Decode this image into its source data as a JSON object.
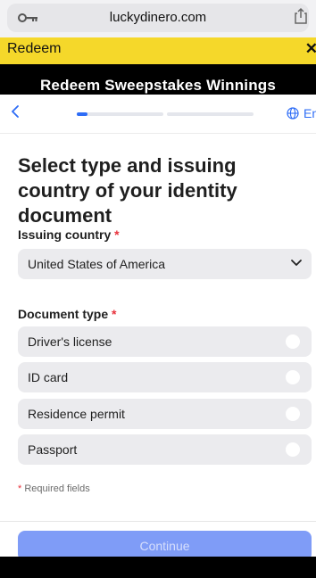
{
  "browser": {
    "domain": "luckydinero.com"
  },
  "banner": {
    "title": "Redeem",
    "close": "✕"
  },
  "hero": {
    "title": "Redeem Sweepstakes Winnings"
  },
  "nav": {
    "language": "En",
    "progress": {
      "step": 1,
      "of": 2,
      "fraction": 0.12
    }
  },
  "main": {
    "heading": "Select type and issuing country of your identity document",
    "country": {
      "label": "Issuing country",
      "required_mark": "*",
      "value": "United States of America"
    },
    "doc_type": {
      "label": "Document type",
      "required_mark": "*",
      "options": [
        "Driver's license",
        "ID card",
        "Residence permit",
        "Passport"
      ]
    },
    "required_note_mark": "*",
    "required_note": "Required fields",
    "continue_label": "Continue"
  },
  "colors": {
    "accent": "#2d6cf6",
    "banner": "#f5d82a",
    "required": "#e8323c",
    "button": "#7f9cf7"
  },
  "icons": [
    "key-icon",
    "share-icon",
    "chevron-left-icon",
    "globe-icon",
    "chevron-down-icon"
  ]
}
